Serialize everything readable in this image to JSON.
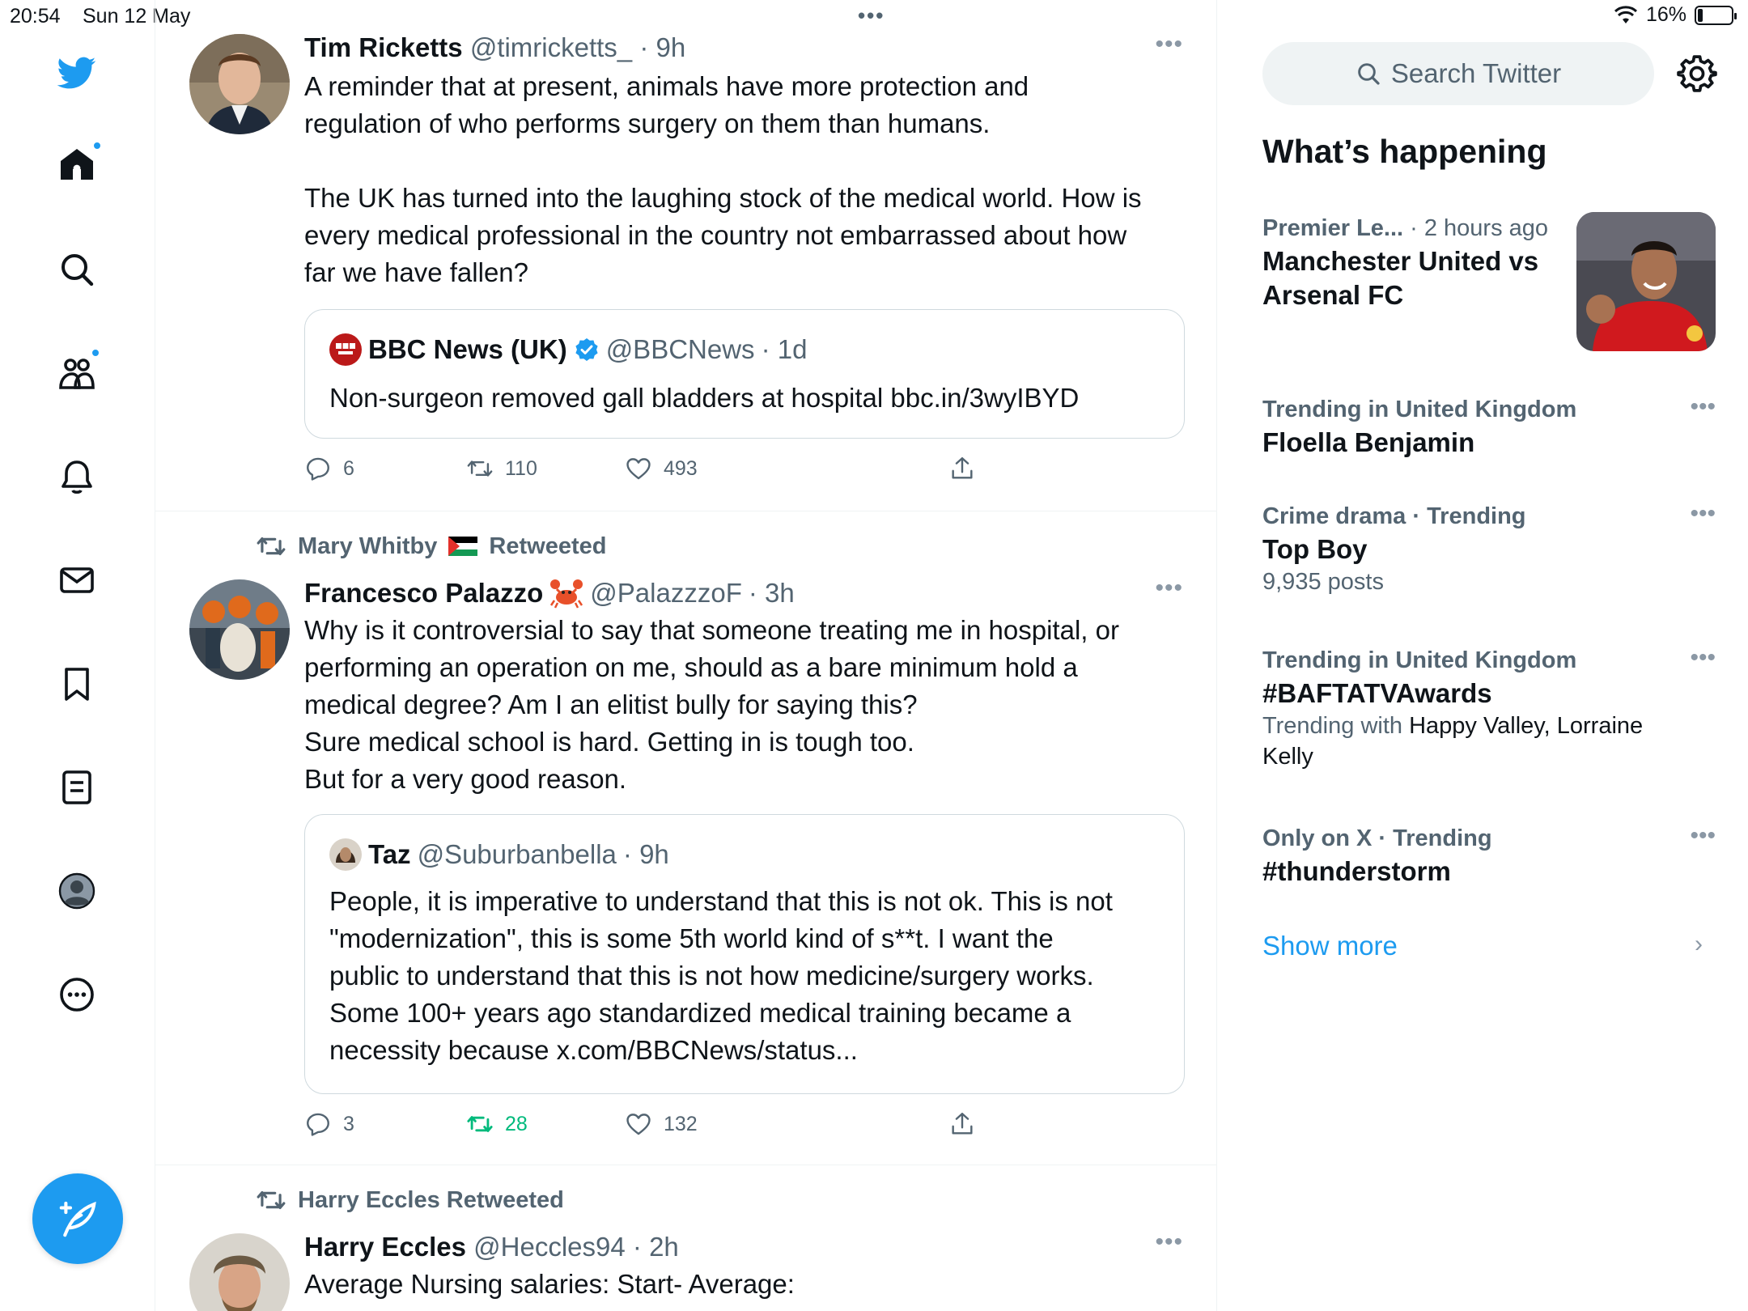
{
  "status_bar": {
    "time": "20:54",
    "date": "Sun 12 May",
    "battery": "16%",
    "battery_level": 0.16
  },
  "compose_icon": "compose-feather-icon",
  "nav": {
    "items": [
      "twitter-logo-icon",
      "home-icon",
      "search-icon",
      "communities-icon",
      "notifications-icon",
      "messages-icon",
      "bookmarks-icon",
      "lists-icon",
      "profile-icon",
      "more-icon"
    ]
  },
  "timeline": {
    "tweets": [
      {
        "name": "Tim Ricketts",
        "handle": "@timricketts_",
        "time": "· 9h",
        "text": "A reminder that at present, animals have more protection and\nregulation of who performs surgery on them than humans.\n\nThe UK has turned into the laughing stock of the medical world. How is\nevery medical professional in the country not embarrassed about how\nfar we have fallen?",
        "quote": {
          "name": "BBC News (UK)",
          "handle": "@BBCNews",
          "time": "· 1d",
          "text": "Non-surgeon removed gall bladders at hospital bbc.in/3wyIBYD"
        },
        "replies": "6",
        "retweets": "110",
        "likes": "493"
      },
      {
        "retweeted_by": "Mary Whitby",
        "retweeted_label": "Retweeted",
        "name": "Francesco Palazzo",
        "handle": "@PalazzzoF",
        "time": "· 3h",
        "text": "Why is it controversial to say that someone treating me in hospital, or\nperforming an operation on me, should as a bare minimum hold a\nmedical degree? Am I an elitist bully for saying this?\nSure medical school is hard. Getting in is tough too.\nBut for a very good reason.",
        "quote": {
          "name": "Taz",
          "handle": "@Suburbanbella",
          "time": "· 9h",
          "text": "People, it is imperative to understand that this is not ok. This is not\n\"modernization\", this is some 5th world kind of s**t. I want the\npublic to understand that this is not how medicine/surgery works.\nSome 100+ years ago standardized medical training became a\nnecessity because x.com/BBCNews/status..."
        },
        "replies": "3",
        "retweets": "28",
        "likes": "132"
      },
      {
        "retweeted_line": "Harry Eccles Retweeted",
        "name": "Harry Eccles",
        "handle": "@Heccles94",
        "time": "· 2h",
        "text": "Average Nursing salaries: Start- Average:"
      }
    ]
  },
  "right": {
    "search_placeholder": "Search Twitter",
    "whats_happening": "What’s happening",
    "trends": [
      {
        "meta_bold": "Premier Le...",
        "meta": " · 2 hours ago",
        "title": "Manchester United vs\nArsenal FC"
      },
      {
        "meta_bold": "Trending in United Kingdom",
        "title": "Floella Benjamin"
      },
      {
        "meta_bold": "Crime drama · Trending",
        "title": "Top Boy",
        "sub": "9,935 posts"
      },
      {
        "meta_bold": "Trending in United Kingdom",
        "title": "#BAFTATVAwards",
        "sub_prefix": "Trending with ",
        "sub_names": "Happy Valley, Lorraine\nKelly"
      },
      {
        "meta_bold": "Only on X · Trending",
        "title": "#thunderstorm"
      }
    ],
    "show_more": "Show more"
  },
  "colors": {
    "accent": "#1d9bf0",
    "retweet_active": "#00ba7c",
    "secondary_text": "#536471"
  }
}
